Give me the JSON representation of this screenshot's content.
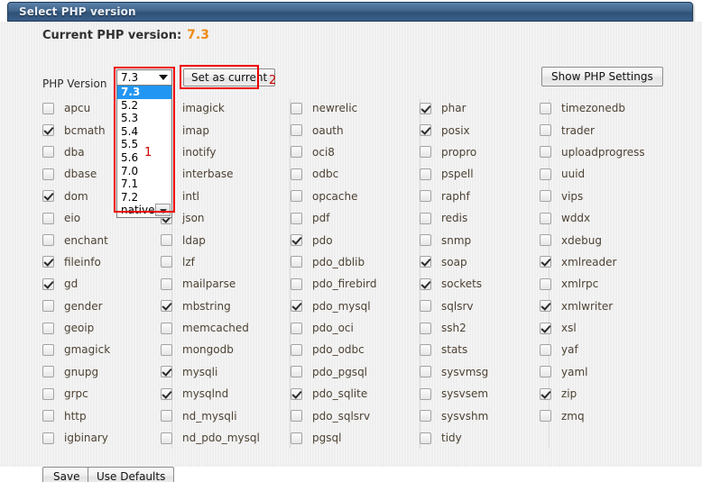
{
  "window": {
    "title": "Select PHP version"
  },
  "header": {
    "current_label": "Current PHP version:",
    "current_value": "7.3",
    "accent_color": "#ef8b17"
  },
  "version_row": {
    "label": "PHP Version",
    "selected": "7.3",
    "options": [
      "7.3",
      "5.2",
      "5.3",
      "5.4",
      "5.5",
      "5.6",
      "7.0",
      "7.1",
      "7.2",
      "native"
    ],
    "set_current_label": "Set as current",
    "show_settings_label": "Show PHP Settings"
  },
  "annotations": {
    "marker_1": "1",
    "marker_2": "2",
    "color": "#ee0000"
  },
  "footer": {
    "save_label": "Save",
    "use_defaults_label": "Use Defaults"
  },
  "extensions": {
    "columns": [
      [
        {
          "name": "apcu",
          "checked": false
        },
        {
          "name": "bcmath",
          "checked": true
        },
        {
          "name": "dba",
          "checked": false
        },
        {
          "name": "dbase",
          "checked": false
        },
        {
          "name": "dom",
          "checked": true
        },
        {
          "name": "eio",
          "checked": false
        },
        {
          "name": "enchant",
          "checked": false
        },
        {
          "name": "fileinfo",
          "checked": true
        },
        {
          "name": "gd",
          "checked": true
        },
        {
          "name": "gender",
          "checked": false
        },
        {
          "name": "geoip",
          "checked": false
        },
        {
          "name": "gmagick",
          "checked": false
        },
        {
          "name": "gnupg",
          "checked": false
        },
        {
          "name": "grpc",
          "checked": false
        },
        {
          "name": "http",
          "checked": false
        },
        {
          "name": "igbinary",
          "checked": false
        }
      ],
      [
        {
          "name": "imagick",
          "checked": false
        },
        {
          "name": "imap",
          "checked": false
        },
        {
          "name": "inotify",
          "checked": false
        },
        {
          "name": "interbase",
          "checked": false
        },
        {
          "name": "intl",
          "checked": false
        },
        {
          "name": "json",
          "checked": true
        },
        {
          "name": "ldap",
          "checked": false
        },
        {
          "name": "lzf",
          "checked": false
        },
        {
          "name": "mailparse",
          "checked": false
        },
        {
          "name": "mbstring",
          "checked": true
        },
        {
          "name": "memcached",
          "checked": false
        },
        {
          "name": "mongodb",
          "checked": false
        },
        {
          "name": "mysqli",
          "checked": true
        },
        {
          "name": "mysqlnd",
          "checked": true
        },
        {
          "name": "nd_mysqli",
          "checked": false
        },
        {
          "name": "nd_pdo_mysql",
          "checked": false
        }
      ],
      [
        {
          "name": "newrelic",
          "checked": false
        },
        {
          "name": "oauth",
          "checked": false
        },
        {
          "name": "oci8",
          "checked": false
        },
        {
          "name": "odbc",
          "checked": false
        },
        {
          "name": "opcache",
          "checked": false
        },
        {
          "name": "pdf",
          "checked": false
        },
        {
          "name": "pdo",
          "checked": true
        },
        {
          "name": "pdo_dblib",
          "checked": false
        },
        {
          "name": "pdo_firebird",
          "checked": false
        },
        {
          "name": "pdo_mysql",
          "checked": true
        },
        {
          "name": "pdo_oci",
          "checked": false
        },
        {
          "name": "pdo_odbc",
          "checked": false
        },
        {
          "name": "pdo_pgsql",
          "checked": false
        },
        {
          "name": "pdo_sqlite",
          "checked": true
        },
        {
          "name": "pdo_sqlsrv",
          "checked": false
        },
        {
          "name": "pgsql",
          "checked": false
        }
      ],
      [
        {
          "name": "phar",
          "checked": true
        },
        {
          "name": "posix",
          "checked": true
        },
        {
          "name": "propro",
          "checked": false
        },
        {
          "name": "pspell",
          "checked": false
        },
        {
          "name": "raphf",
          "checked": false
        },
        {
          "name": "redis",
          "checked": false
        },
        {
          "name": "snmp",
          "checked": false
        },
        {
          "name": "soap",
          "checked": true
        },
        {
          "name": "sockets",
          "checked": true
        },
        {
          "name": "sqlsrv",
          "checked": false
        },
        {
          "name": "ssh2",
          "checked": false
        },
        {
          "name": "stats",
          "checked": false
        },
        {
          "name": "sysvmsg",
          "checked": false
        },
        {
          "name": "sysvsem",
          "checked": false
        },
        {
          "name": "sysvshm",
          "checked": false
        },
        {
          "name": "tidy",
          "checked": false
        }
      ],
      [
        {
          "name": "timezonedb",
          "checked": false
        },
        {
          "name": "trader",
          "checked": false
        },
        {
          "name": "uploadprogress",
          "checked": false
        },
        {
          "name": "uuid",
          "checked": false
        },
        {
          "name": "vips",
          "checked": false
        },
        {
          "name": "wddx",
          "checked": false
        },
        {
          "name": "xdebug",
          "checked": false
        },
        {
          "name": "xmlreader",
          "checked": true
        },
        {
          "name": "xmlrpc",
          "checked": false
        },
        {
          "name": "xmlwriter",
          "checked": true
        },
        {
          "name": "xsl",
          "checked": true
        },
        {
          "name": "yaf",
          "checked": false
        },
        {
          "name": "yaml",
          "checked": false
        },
        {
          "name": "zip",
          "checked": true
        },
        {
          "name": "zmq",
          "checked": false
        }
      ]
    ]
  }
}
